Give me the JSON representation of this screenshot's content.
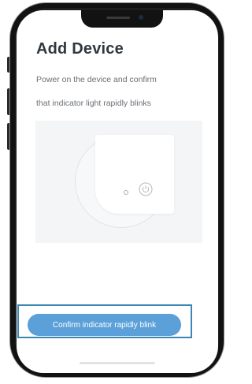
{
  "header": {
    "title": "Add Device"
  },
  "instructions": {
    "line1": "Power on the device and confirm",
    "line2": "that indicator light rapidly blinks"
  },
  "illustration": {
    "led_icon": "indicator-led-icon",
    "power_icon": "power-icon"
  },
  "actions": {
    "confirm_label": "Confirm indicator rapidly blink"
  },
  "colors": {
    "primary_button": "#5ba0d8",
    "highlight_frame": "#3b86b4",
    "title_text": "#2f3740",
    "body_text": "#6a6f75",
    "illustration_bg": "#f4f5f6"
  }
}
